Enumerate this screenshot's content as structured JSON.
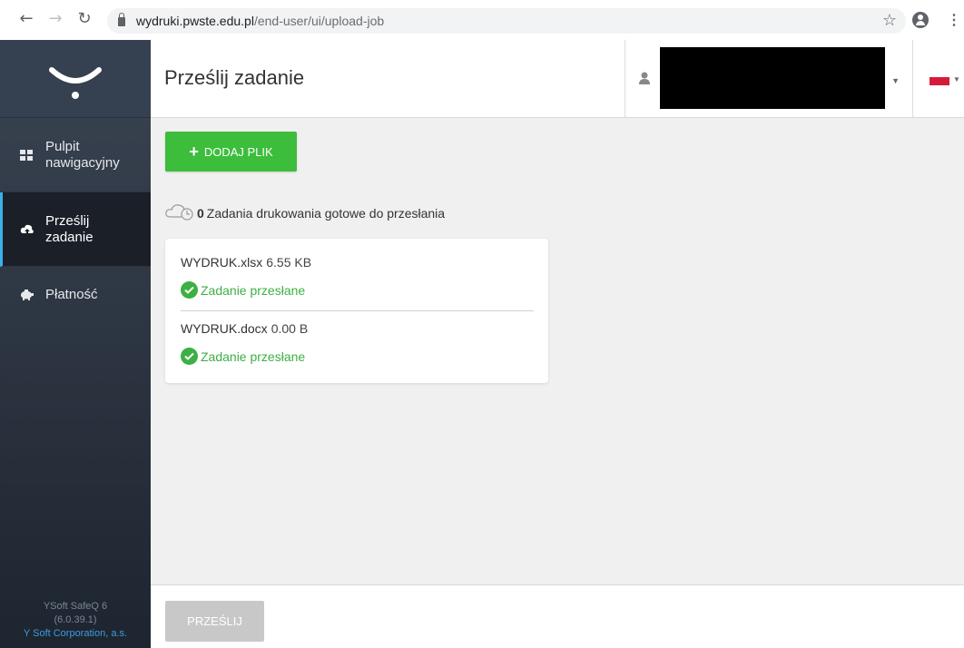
{
  "browser": {
    "url_host": "wydruki.pwste.edu.pl",
    "url_path": "/end-user/ui/upload-job"
  },
  "sidebar": {
    "items": [
      {
        "label_line1": "Pulpit",
        "label_line2": "nawigacyjny",
        "icon": "dashboard-grid-icon"
      },
      {
        "label_line1": "Prześlij",
        "label_line2": "zadanie",
        "icon": "cloud-upload-icon",
        "active": true
      },
      {
        "label_line1": "Płatność",
        "label_line2": "",
        "icon": "piggy-bank-icon"
      }
    ],
    "footer": {
      "product": "YSoft SafeQ 6",
      "version": "(6.0.39.1)",
      "company": "Y Soft Corporation, a.s."
    }
  },
  "header": {
    "title": "Prześlij zadanie"
  },
  "content": {
    "add_button_label": "DODAJ PLIK",
    "status_count": "0",
    "status_text": "Zadania drukowania gotowe do przesłania",
    "files": [
      {
        "name": "WYDRUK.xlsx",
        "size": "6.55 KB",
        "status": "Zadanie przesłane"
      },
      {
        "name": "WYDRUK.docx",
        "size": "0.00 B",
        "status": "Zadanie przesłane"
      }
    ]
  },
  "footer": {
    "send_button_label": "PRZEŚLIJ"
  },
  "colors": {
    "accent_green": "#3cbe3c",
    "success_green": "#3cb043",
    "sidebar_active_border": "#3bb0e8",
    "flag_red": "#d61a3c"
  }
}
